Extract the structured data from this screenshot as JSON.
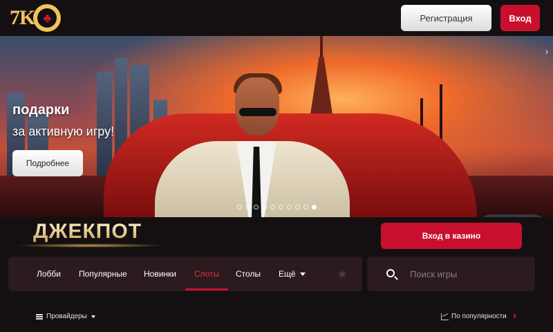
{
  "header": {
    "logo_text": "7K",
    "logo_chip_symbol": "♣",
    "register_label": "Регистрация",
    "login_label": "Вход"
  },
  "banner": {
    "title": "подарки",
    "subtitle": "за активную игру!",
    "more_label": "Подробнее",
    "slide_count": 10,
    "active_slide": 10
  },
  "jackpot": {
    "title": "ДЖЕКПОТ",
    "casino_login_label": "Вход в казино"
  },
  "nav": {
    "items": [
      {
        "label": "Лобби"
      },
      {
        "label": "Популярные"
      },
      {
        "label": "Новинки"
      },
      {
        "label": "Слоты"
      },
      {
        "label": "Столы"
      },
      {
        "label": "Ещё"
      }
    ],
    "active": "Слоты"
  },
  "search": {
    "placeholder": "Поиск игры"
  },
  "filters": {
    "providers_label": "Провайдеры",
    "sort_label": "По популярности"
  },
  "colors": {
    "accent": "#c8102e",
    "background": "#141012",
    "panel": "#2b1a1e",
    "gold": "#f0c35a"
  }
}
